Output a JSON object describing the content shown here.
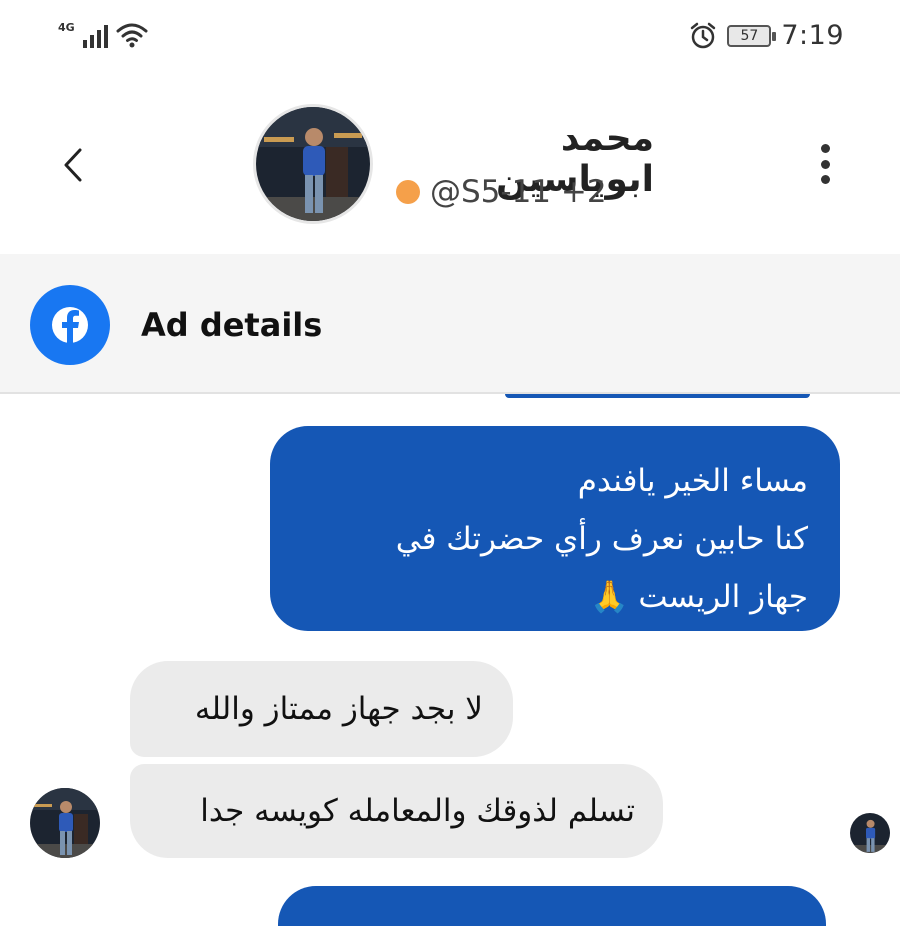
{
  "status_bar": {
    "network_type": "4G",
    "signal_icon": "signal-bars-icon",
    "wifi_icon": "wifi-icon",
    "alarm_icon": "alarm-clock-icon",
    "battery_level": "57",
    "time": "7:19"
  },
  "header": {
    "back_icon": "chevron-left-icon",
    "contact_name": "محمد ابوياسين",
    "contact_handle": "@S5-11 +2",
    "status_dot_color": "#f5a04a",
    "more_icon": "more-vertical-icon"
  },
  "ad_bar": {
    "icon": "facebook-icon",
    "label": "Ad details"
  },
  "messages": [
    {
      "direction": "outgoing",
      "lines": [
        "مساء الخير يافندم",
        "كنا حابين نعرف رأي حضرتك في",
        "جهاز الريست 🙏"
      ]
    },
    {
      "direction": "incoming",
      "text": "لا بجد جهاز ممتاز والله"
    },
    {
      "direction": "incoming",
      "text": "تسلم لذوقك والمعامله كويسه جدا"
    }
  ],
  "colors": {
    "outgoing_bubble": "#1557b5",
    "incoming_bubble": "#ebebeb",
    "facebook_blue": "#1877f2"
  }
}
